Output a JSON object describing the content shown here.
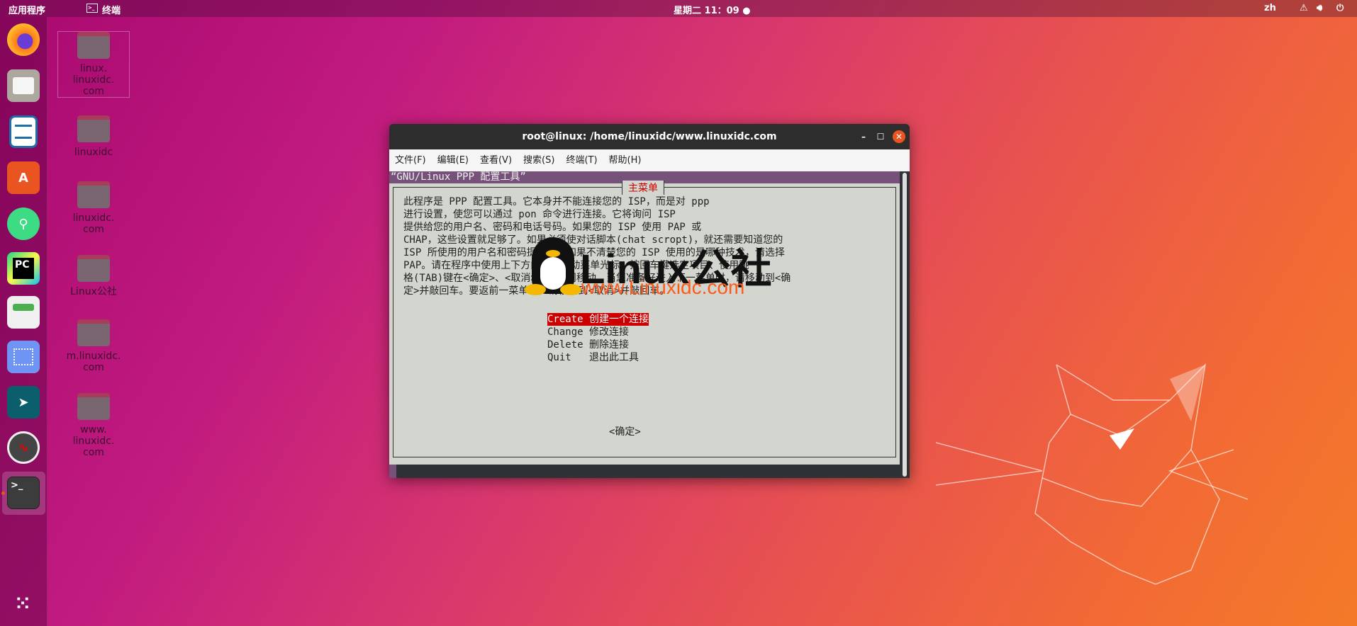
{
  "topbar": {
    "activities": "应用程序",
    "app_name": "终端",
    "clock": "星期二 11：09 ●",
    "input_method": "zh"
  },
  "dock": {
    "items": [
      "firefox",
      "files",
      "libreoffice-writer",
      "ubuntu-software",
      "android-studio",
      "pycharm",
      "tweaks",
      "screenshot",
      "app-store",
      "web-spider",
      "terminal"
    ]
  },
  "desktop": {
    "folders": [
      [
        "linux.",
        "linuxidc.",
        "com"
      ],
      [
        "linuxidc"
      ],
      [
        "linuxidc.",
        "com"
      ],
      [
        "Linux公社"
      ],
      [
        "m.linuxidc.",
        "com"
      ],
      [
        "www.",
        "linuxidc.",
        "com"
      ]
    ]
  },
  "window": {
    "title": "root@linux: /home/linuxidc/www.linuxidc.com",
    "menu": [
      "文件(F)",
      "编辑(E)",
      "查看(V)",
      "搜索(S)",
      "终端(T)",
      "帮助(H)"
    ],
    "backtitle": "“GNU/Linux PPP 配置工具”",
    "dialog_title": "主菜单",
    "body_lines": [
      "此程序是 PPP 配置工具。它本身并不能连接您的 ISP，而是对 ppp",
      "进行设置，使您可以通过 pon 命令进行连接。它将询问 ISP",
      "提供给您的用户名、密码和电话号码。如果您的 ISP 使用 PAP 或",
      "CHAP，这些设置就足够了。如果必须使对话脚本(chat scropt)，就还需要知道您的",
      "ISP 所使用的用户名和密码提示符。如果不清楚您的 ISP 使用的是哪种技术，请选择",
      "PAP。请在程序中使用上下方向键来移动菜单光标，按回车键选定项目、使用跳",
      "格(TAB)键在<确定>、<取消>和菜单间移动。当您准备好进入下一菜单时，请移动到<确",
      "定>并敲回车。要返前一菜单时，请移动到<取消>并敲回车。"
    ],
    "menu_items": [
      {
        "key": "Create",
        "label": "创建一个连接"
      },
      {
        "key": "Change",
        "label": "修改连接"
      },
      {
        "key": "Delete",
        "label": "删除连接"
      },
      {
        "key": "Quit  ",
        "label": "退出此工具"
      }
    ],
    "ok_button": "<确定>"
  },
  "watermark": {
    "brand": "Linux公社",
    "url": "www.Linuxidc.com"
  }
}
